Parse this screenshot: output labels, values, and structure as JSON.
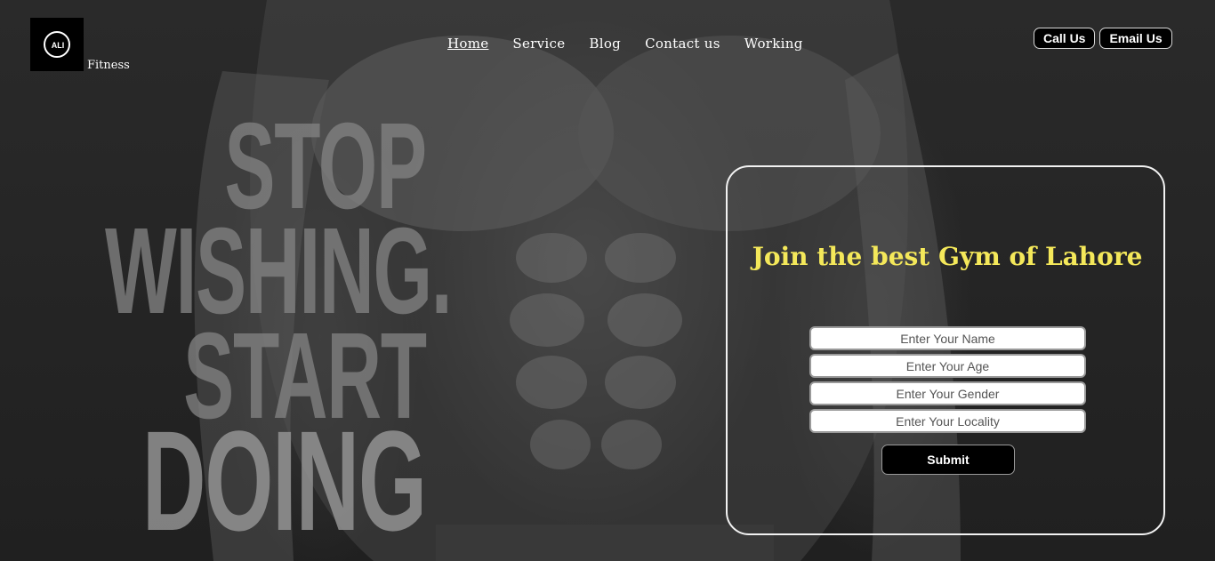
{
  "brand": {
    "logo_mark": "ALI",
    "name": "Fitness"
  },
  "nav": {
    "items": [
      {
        "label": "Home",
        "active": true
      },
      {
        "label": "Service"
      },
      {
        "label": "Blog"
      },
      {
        "label": "Contact us"
      },
      {
        "label": "Working"
      }
    ]
  },
  "actions": {
    "call_label": "Call Us",
    "email_label": "Email Us"
  },
  "hero": {
    "lines": [
      "STOP",
      "WISHING.",
      "START",
      "DOING"
    ]
  },
  "form": {
    "title": "Join the best Gym of Lahore",
    "fields": {
      "name_placeholder": "Enter Your Name",
      "age_placeholder": "Enter Your Age",
      "gender_placeholder": "Enter Your Gender",
      "locality_placeholder": "Enter Your Locality"
    },
    "submit_label": "Submit"
  },
  "colors": {
    "title_yellow": "#f4e85a",
    "button_black": "#000000",
    "card_border": "#f2f2f2"
  }
}
